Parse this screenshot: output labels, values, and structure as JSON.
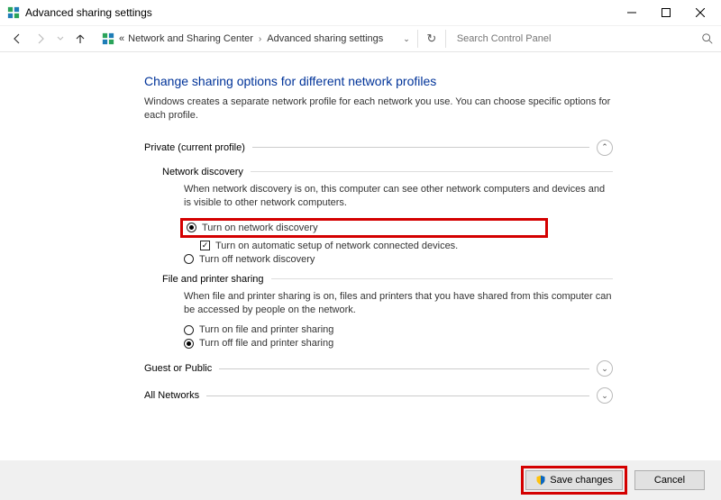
{
  "window": {
    "title": "Advanced sharing settings"
  },
  "breadcrumb": {
    "ellipsis": "«",
    "a": "Network and Sharing Center",
    "b": "Advanced sharing settings"
  },
  "search": {
    "placeholder": "Search Control Panel"
  },
  "heading": "Change sharing options for different network profiles",
  "intro": "Windows creates a separate network profile for each network you use. You can choose specific options for each profile.",
  "private": {
    "title": "Private (current profile)",
    "discovery": {
      "title": "Network discovery",
      "desc": "When network discovery is on, this computer can see other network computers and devices and is visible to other network computers.",
      "on": "Turn on network discovery",
      "auto": "Turn on automatic setup of network connected devices.",
      "off": "Turn off network discovery"
    },
    "fps": {
      "title": "File and printer sharing",
      "desc": "When file and printer sharing is on, files and printers that you have shared from this computer can be accessed by people on the network.",
      "on": "Turn on file and printer sharing",
      "off": "Turn off file and printer sharing"
    }
  },
  "guest": {
    "title": "Guest or Public"
  },
  "all": {
    "title": "All Networks"
  },
  "buttons": {
    "save": "Save changes",
    "cancel": "Cancel"
  }
}
